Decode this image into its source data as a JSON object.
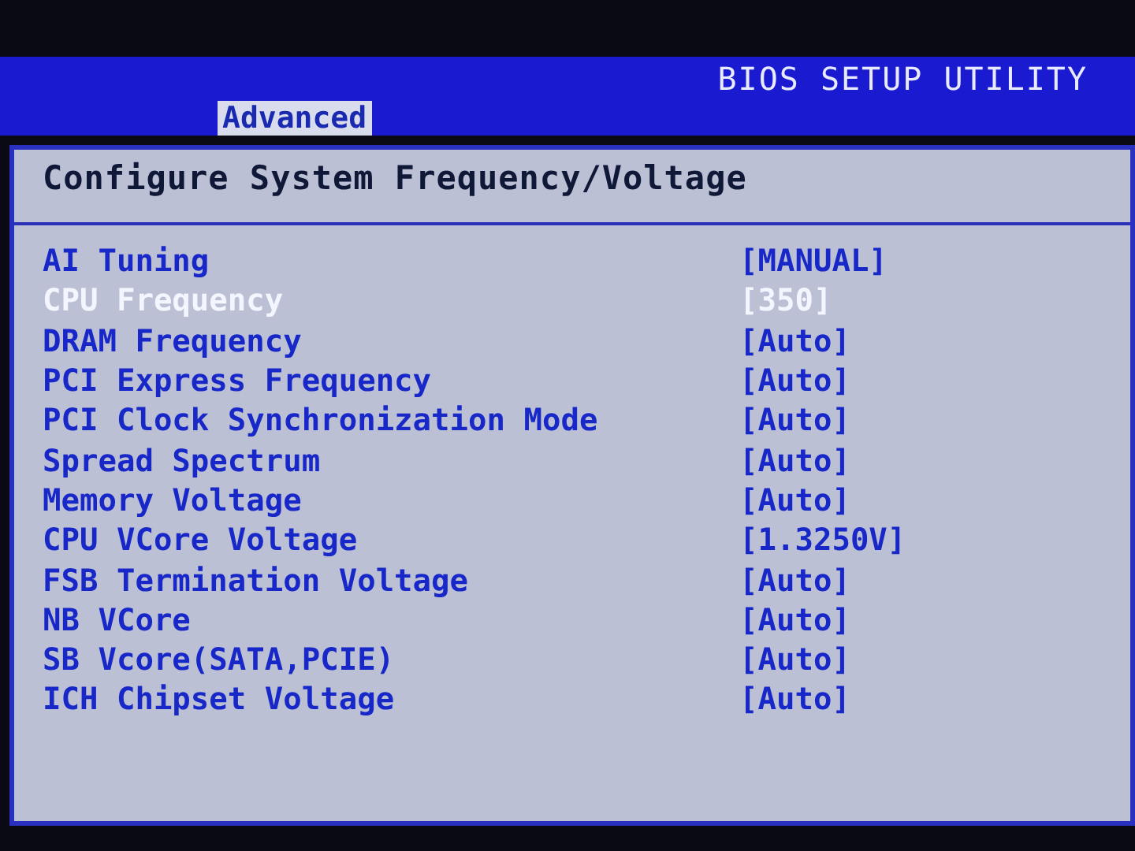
{
  "window": {
    "title": "BIOS SETUP UTILITY"
  },
  "tabs": [
    {
      "label": "Advanced",
      "selected": true
    }
  ],
  "heading": "Configure System Frequency/Voltage",
  "settings": [
    {
      "label": "AI Tuning",
      "value": "[MANUAL]",
      "selected": false
    },
    {
      "label": "CPU Frequency",
      "value": "[350]",
      "selected": true
    },
    {
      "label": "DRAM Frequency",
      "value": "[Auto]",
      "selected": false
    },
    {
      "label": "PCI Express Frequency",
      "value": "[Auto]",
      "selected": false
    },
    {
      "label": "PCI Clock Synchronization Mode",
      "value": "[Auto]",
      "selected": false
    },
    {
      "label": "Spread Spectrum",
      "value": "[Auto]",
      "selected": false
    },
    {
      "label": "Memory Voltage",
      "value": "[Auto]",
      "selected": false
    },
    {
      "label": "CPU VCore Voltage",
      "value": "[1.3250V]",
      "selected": false
    },
    {
      "label": "FSB Termination Voltage",
      "value": "[Auto]",
      "selected": false
    },
    {
      "label": "NB VCore",
      "value": "[Auto]",
      "selected": false
    },
    {
      "label": "SB Vcore(SATA,PCIE)",
      "value": "[Auto]",
      "selected": false
    },
    {
      "label": "ICH Chipset Voltage",
      "value": "[Auto]",
      "selected": false
    }
  ]
}
